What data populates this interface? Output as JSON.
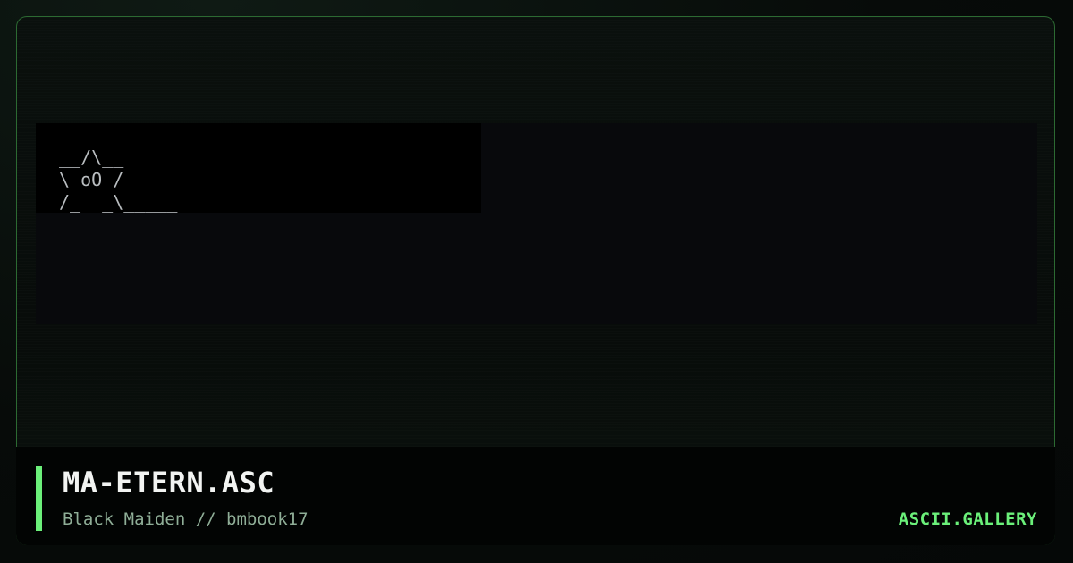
{
  "art": {
    "lines": [
      "__/\\__",
      "\\ oO /",
      "/_  _\\_____"
    ]
  },
  "footer": {
    "title": "MA-ETERN.ASC",
    "subtitle": "Black Maiden // bmbook17",
    "brand": "ASCII.GALLERY"
  },
  "colors": {
    "accent": "#6bf07a",
    "frame_border": "#2c6a32",
    "art_text": "#b9bdc0",
    "title_text": "#f2f4f2",
    "subtitle_text": "#8fae97"
  }
}
